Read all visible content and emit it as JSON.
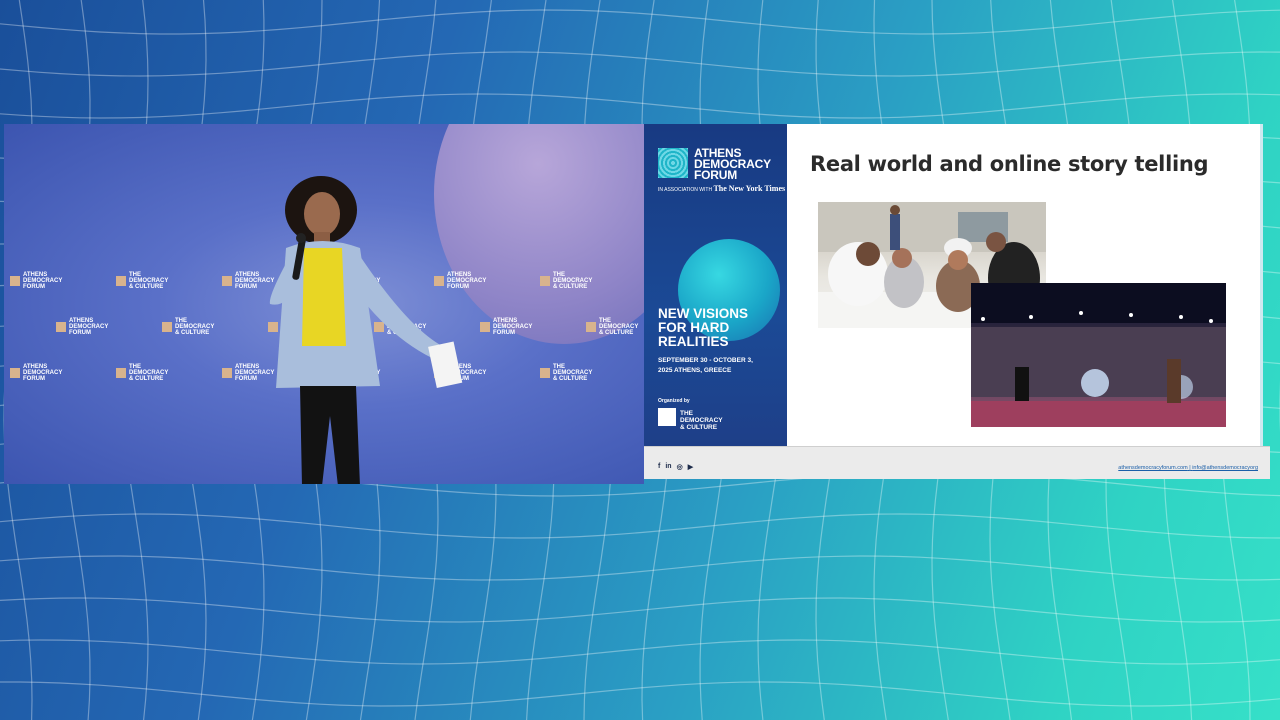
{
  "video": {
    "backdrop_logos": [
      {
        "line1": "ATHENS",
        "line2": "DEMOCRACY",
        "line3": "FORUM"
      },
      {
        "line1": "THE",
        "line2": "DEMOCRACY",
        "line3": "& CULTURE"
      }
    ]
  },
  "slide": {
    "brand_lines": [
      "ATHENS",
      "DEMOCRACY",
      "FORUM"
    ],
    "association": "IN ASSOCIATION WITH",
    "nyt": "The New York Times",
    "headline_lines": [
      "NEW VISIONS",
      "FOR HARD",
      "REALITIES"
    ],
    "dates_line1": "SEPTEMBER 30 - OCTOBER 3,",
    "dates_line2": "2025 ATHENS, GREECE",
    "organized_by": "Organized by",
    "organizer_lines": [
      "THE",
      "DEMOCRACY",
      "& CULTURE"
    ],
    "title": "Real world and online story telling",
    "footer": {
      "social_icons": [
        "facebook-icon",
        "linkedin-icon",
        "instagram-icon",
        "youtube-icon"
      ],
      "social_glyphs": [
        "f",
        "in",
        "◎",
        "▶"
      ],
      "site": "athensdemocracyforum.com",
      "separator": "|",
      "email": "info@athensdemocracyorg"
    }
  },
  "colors": {
    "slide_blue": "#183a82",
    "accent_cyan": "#1fb5c8",
    "title_text": "#2b2b2b",
    "link": "#1b5fa8"
  }
}
